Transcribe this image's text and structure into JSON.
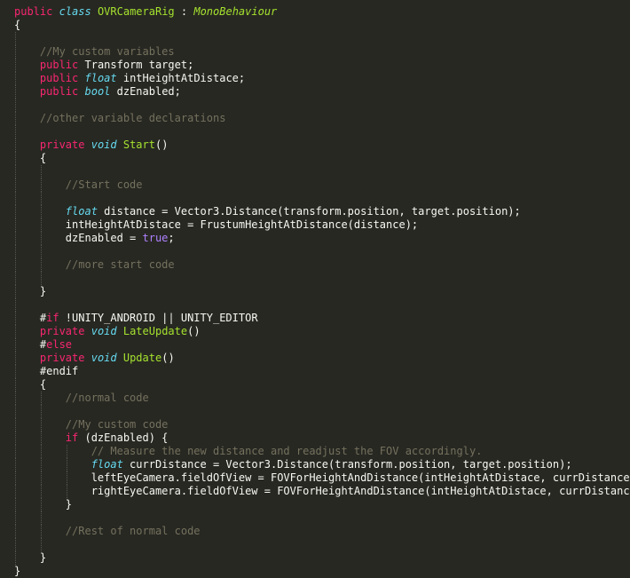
{
  "editor": {
    "language": "C#",
    "theme": {
      "background": "#272822",
      "foreground": "#F8F8F2",
      "keyword": "#F92672",
      "type": "#66D9EF",
      "entity": "#A6E22E",
      "comment": "#75715E",
      "constant": "#AE81FF"
    },
    "lines": [
      {
        "guides": [],
        "tokens": [
          {
            "t": "public",
            "c": "kw"
          },
          {
            "t": " ",
            "c": "pl"
          },
          {
            "t": "class",
            "c": "ty"
          },
          {
            "t": " ",
            "c": "pl"
          },
          {
            "t": "OVRCameraRig",
            "c": "ent"
          },
          {
            "t": " : ",
            "c": "pl"
          },
          {
            "t": "MonoBehaviour",
            "c": "inh"
          }
        ]
      },
      {
        "guides": [],
        "tokens": [
          {
            "t": "{",
            "c": "pl"
          }
        ]
      },
      {
        "guides": [
          0
        ],
        "tokens": []
      },
      {
        "guides": [
          0
        ],
        "tokens": [
          {
            "t": "    //My custom variables",
            "c": "co"
          }
        ]
      },
      {
        "guides": [
          0
        ],
        "tokens": [
          {
            "t": "    ",
            "c": "pl"
          },
          {
            "t": "public",
            "c": "kw"
          },
          {
            "t": " Transform target;",
            "c": "pl"
          }
        ]
      },
      {
        "guides": [
          0
        ],
        "tokens": [
          {
            "t": "    ",
            "c": "pl"
          },
          {
            "t": "public",
            "c": "kw"
          },
          {
            "t": " ",
            "c": "pl"
          },
          {
            "t": "float",
            "c": "ty"
          },
          {
            "t": " intHeightAtDistace;",
            "c": "pl"
          }
        ]
      },
      {
        "guides": [
          0
        ],
        "tokens": [
          {
            "t": "    ",
            "c": "pl"
          },
          {
            "t": "public",
            "c": "kw"
          },
          {
            "t": " ",
            "c": "pl"
          },
          {
            "t": "bool",
            "c": "ty"
          },
          {
            "t": " dzEnabled;",
            "c": "pl"
          }
        ]
      },
      {
        "guides": [
          0
        ],
        "tokens": []
      },
      {
        "guides": [
          0
        ],
        "tokens": [
          {
            "t": "    //other variable declarations",
            "c": "co"
          }
        ]
      },
      {
        "guides": [
          0
        ],
        "tokens": []
      },
      {
        "guides": [
          0
        ],
        "tokens": [
          {
            "t": "    ",
            "c": "pl"
          },
          {
            "t": "private",
            "c": "kw"
          },
          {
            "t": " ",
            "c": "pl"
          },
          {
            "t": "void",
            "c": "ty"
          },
          {
            "t": " ",
            "c": "pl"
          },
          {
            "t": "Start",
            "c": "ent"
          },
          {
            "t": "()",
            "c": "pl"
          }
        ]
      },
      {
        "guides": [
          0
        ],
        "tokens": [
          {
            "t": "    {",
            "c": "pl"
          }
        ]
      },
      {
        "guides": [
          0,
          1
        ],
        "tokens": []
      },
      {
        "guides": [
          0,
          1
        ],
        "tokens": [
          {
            "t": "        //Start code",
            "c": "co"
          }
        ]
      },
      {
        "guides": [
          0,
          1
        ],
        "tokens": []
      },
      {
        "guides": [
          0,
          1
        ],
        "tokens": [
          {
            "t": "        ",
            "c": "pl"
          },
          {
            "t": "float",
            "c": "ty"
          },
          {
            "t": " distance = Vector3.Distance(transform.position, target.position);",
            "c": "pl"
          }
        ]
      },
      {
        "guides": [
          0,
          1
        ],
        "tokens": [
          {
            "t": "        intHeightAtDistace = FrustumHeightAtDistance(distance);",
            "c": "pl"
          }
        ]
      },
      {
        "guides": [
          0,
          1
        ],
        "tokens": [
          {
            "t": "        dzEnabled = ",
            "c": "pl"
          },
          {
            "t": "true",
            "c": "cst"
          },
          {
            "t": ";",
            "c": "pl"
          }
        ]
      },
      {
        "guides": [
          0,
          1
        ],
        "tokens": []
      },
      {
        "guides": [
          0,
          1
        ],
        "tokens": [
          {
            "t": "        //more start code",
            "c": "co"
          }
        ]
      },
      {
        "guides": [
          0,
          1
        ],
        "tokens": []
      },
      {
        "guides": [
          0
        ],
        "tokens": [
          {
            "t": "    }",
            "c": "pl"
          }
        ]
      },
      {
        "guides": [
          0
        ],
        "tokens": []
      },
      {
        "guides": [
          0
        ],
        "tokens": [
          {
            "t": "    #",
            "c": "pl"
          },
          {
            "t": "if",
            "c": "kw"
          },
          {
            "t": " !UNITY_ANDROID || UNITY_EDITOR",
            "c": "pl"
          }
        ]
      },
      {
        "guides": [
          0
        ],
        "tokens": [
          {
            "t": "    ",
            "c": "pl"
          },
          {
            "t": "private",
            "c": "kw"
          },
          {
            "t": " ",
            "c": "pl"
          },
          {
            "t": "void",
            "c": "ty"
          },
          {
            "t": " ",
            "c": "pl"
          },
          {
            "t": "LateUpdate",
            "c": "ent"
          },
          {
            "t": "()",
            "c": "pl"
          }
        ]
      },
      {
        "guides": [
          0
        ],
        "tokens": [
          {
            "t": "    #",
            "c": "pl"
          },
          {
            "t": "else",
            "c": "kw"
          }
        ]
      },
      {
        "guides": [
          0
        ],
        "tokens": [
          {
            "t": "    ",
            "c": "pl"
          },
          {
            "t": "private",
            "c": "kw"
          },
          {
            "t": " ",
            "c": "pl"
          },
          {
            "t": "void",
            "c": "ty"
          },
          {
            "t": " ",
            "c": "pl"
          },
          {
            "t": "Update",
            "c": "ent"
          },
          {
            "t": "()",
            "c": "pl"
          }
        ]
      },
      {
        "guides": [
          0
        ],
        "tokens": [
          {
            "t": "    #endif",
            "c": "pl"
          }
        ]
      },
      {
        "guides": [
          0
        ],
        "tokens": [
          {
            "t": "    {",
            "c": "pl"
          }
        ]
      },
      {
        "guides": [
          0,
          1
        ],
        "tokens": [
          {
            "t": "        //normal code",
            "c": "co"
          }
        ]
      },
      {
        "guides": [
          0,
          1
        ],
        "tokens": []
      },
      {
        "guides": [
          0,
          1
        ],
        "tokens": [
          {
            "t": "        //My custom code",
            "c": "co"
          }
        ]
      },
      {
        "guides": [
          0,
          1
        ],
        "tokens": [
          {
            "t": "        ",
            "c": "pl"
          },
          {
            "t": "if",
            "c": "kw"
          },
          {
            "t": " (dzEnabled) {",
            "c": "pl"
          }
        ]
      },
      {
        "guides": [
          0,
          1,
          2
        ],
        "tokens": [
          {
            "t": "            // Measure the new distance and readjust the FOV accordingly.",
            "c": "co"
          }
        ]
      },
      {
        "guides": [
          0,
          1,
          2
        ],
        "tokens": [
          {
            "t": "            ",
            "c": "pl"
          },
          {
            "t": "float",
            "c": "ty"
          },
          {
            "t": " currDistance = Vector3.Distance(transform.position, target.position);",
            "c": "pl"
          }
        ]
      },
      {
        "guides": [
          0,
          1,
          2
        ],
        "tokens": [
          {
            "t": "            leftEyeCamera.fieldOfView = FOVForHeightAndDistance(intHeightAtDistace, currDistance);",
            "c": "pl"
          }
        ]
      },
      {
        "guides": [
          0,
          1,
          2
        ],
        "tokens": [
          {
            "t": "            rightEyeCamera.fieldOfView = FOVForHeightAndDistance(intHeightAtDistace, currDistance);",
            "c": "pl"
          }
        ]
      },
      {
        "guides": [
          0,
          1
        ],
        "tokens": [
          {
            "t": "        }",
            "c": "pl"
          }
        ]
      },
      {
        "guides": [
          0,
          1
        ],
        "tokens": []
      },
      {
        "guides": [
          0,
          1
        ],
        "tokens": [
          {
            "t": "        //Rest of normal code",
            "c": "co"
          }
        ]
      },
      {
        "guides": [
          0,
          1
        ],
        "tokens": []
      },
      {
        "guides": [
          0
        ],
        "tokens": [
          {
            "t": "    }",
            "c": "pl"
          }
        ]
      },
      {
        "guides": [],
        "tokens": [
          {
            "t": "}",
            "c": "pl"
          }
        ]
      }
    ]
  }
}
